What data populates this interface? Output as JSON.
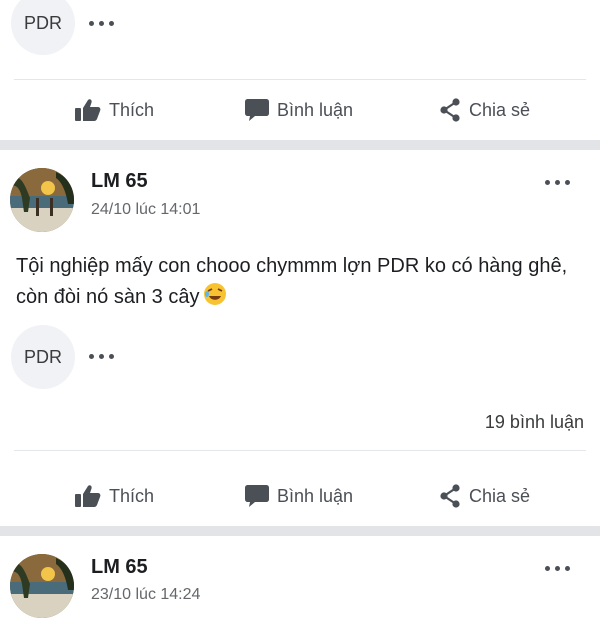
{
  "post_top": {
    "chip_text": "PDR"
  },
  "actions": {
    "like": "Thích",
    "comment": "Bình luận",
    "share": "Chia sẻ"
  },
  "post_main": {
    "author": "LM 65",
    "timestamp": "24/10 lúc 14:01",
    "content": "Tội nghiệp mấy con chooo chymmm lợn PDR ko có hàng ghê, còn đòi nó sàn 3 cây",
    "chip_text": "PDR",
    "comment_count": "19 bình luận"
  },
  "post_bottom": {
    "author": "LM 65",
    "timestamp": "23/10 lúc 14:24"
  },
  "colors": {
    "action_text": "#4b4f56",
    "separator": "#e2e4e8",
    "chip_bg": "#f0f2f5"
  }
}
